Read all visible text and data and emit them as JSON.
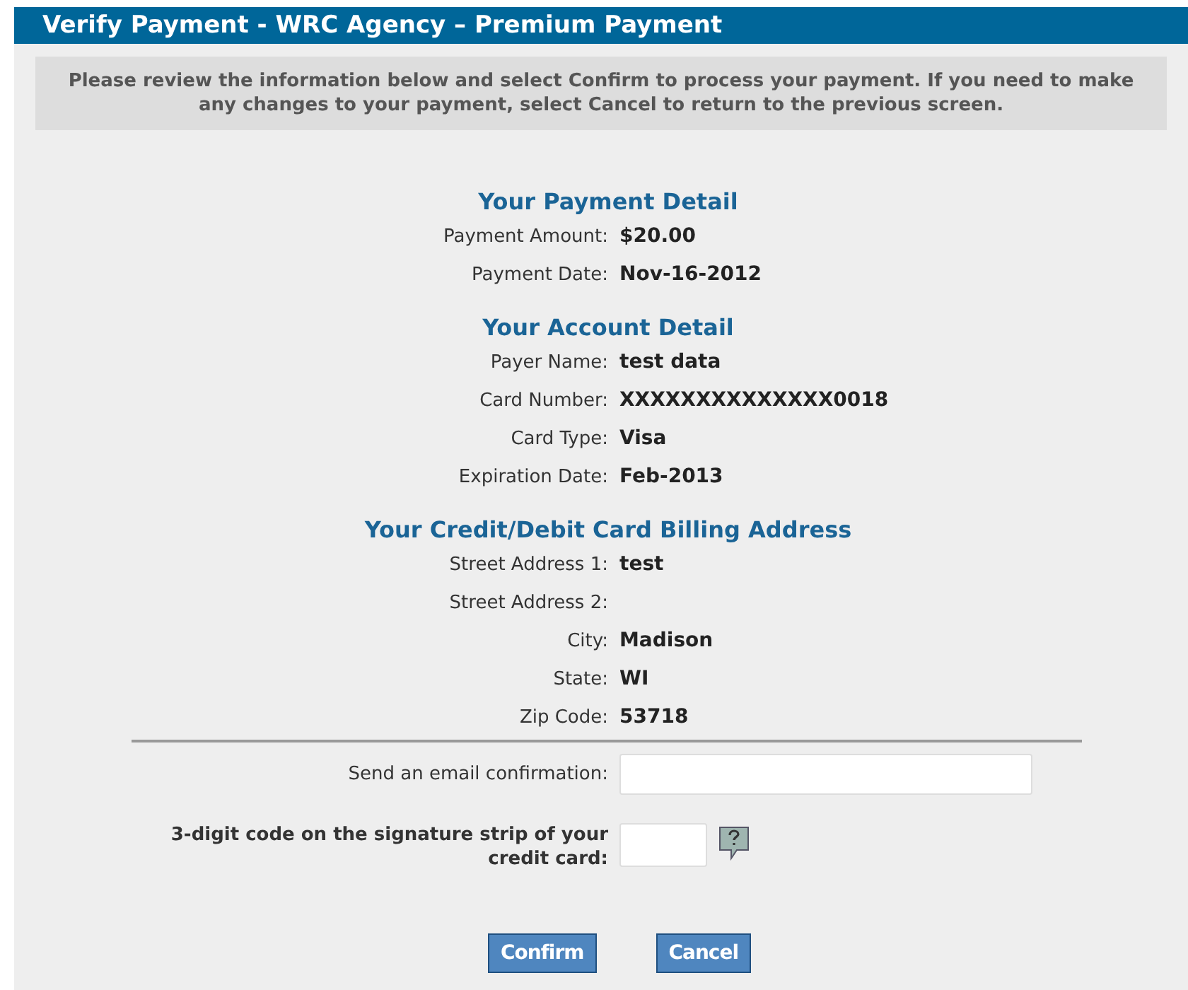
{
  "title": "Verify Payment - WRC Agency – Premium Payment",
  "notice": "Please review the information below and select Confirm to process your payment. If you need to make any changes to your payment, select Cancel to return to the previous screen.",
  "sections": [
    {
      "heading": "Your Payment Detail",
      "rows": [
        {
          "label": "Payment Amount:",
          "value": "$20.00"
        },
        {
          "label": "Payment Date:",
          "value": "Nov-16-2012"
        }
      ]
    },
    {
      "heading": "Your Account Detail",
      "rows": [
        {
          "label": "Payer Name:",
          "value": "test data"
        },
        {
          "label": "Card Number:",
          "value": "XXXXXXXXXXXXXX0018"
        },
        {
          "label": "Card Type:",
          "value": "Visa"
        },
        {
          "label": "Expiration Date:",
          "value": "Feb-2013"
        }
      ]
    },
    {
      "heading": "Your Credit/Debit Card Billing Address",
      "rows": [
        {
          "label": "Street Address 1:",
          "value": "test"
        },
        {
          "label": "Street Address 2:"
        },
        {
          "label": "City:",
          "value": "Madison"
        },
        {
          "label": "State:",
          "value": "WI"
        },
        {
          "label": "Zip Code:",
          "value": "53718"
        }
      ]
    }
  ],
  "email_field": {
    "label": "Send an email confirmation:"
  },
  "code_field": {
    "label": "3-digit code on the signature strip of your credit card:"
  },
  "buttons": [
    "Confirm",
    "Cancel"
  ]
}
